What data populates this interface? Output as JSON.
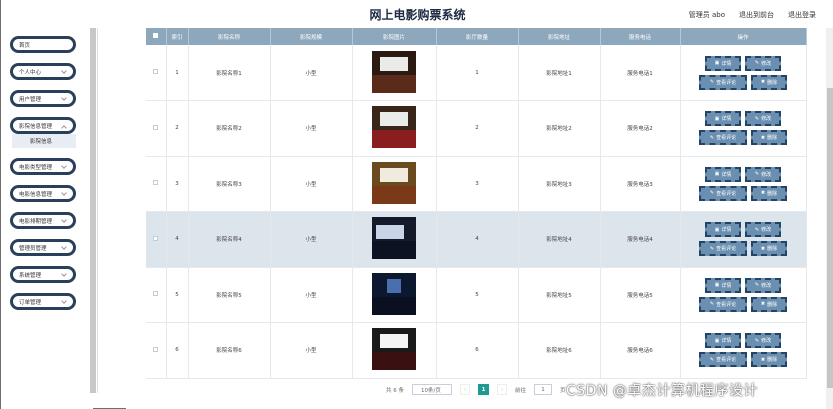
{
  "header": {
    "title": "网上电影购票系统",
    "user": "管理员 abo",
    "exit_to_frontend": "退出到前台",
    "logout": "退出登录"
  },
  "sidebar": {
    "items": [
      {
        "label": "首页"
      },
      {
        "label": "个人中心"
      },
      {
        "label": "用户管理"
      },
      {
        "label": "影院信息管理",
        "children": [
          "影院信息"
        ]
      },
      {
        "label": "电影类型管理"
      },
      {
        "label": "电影信息管理"
      },
      {
        "label": "电影排期管理"
      },
      {
        "label": "管理员管理"
      },
      {
        "label": "系统管理"
      },
      {
        "label": "订单管理"
      }
    ]
  },
  "table": {
    "columns": [
      "索引",
      "影院名称",
      "影院规模",
      "影院图片",
      "影厅数量",
      "影院地址",
      "服务电话",
      "操作"
    ],
    "rows": [
      {
        "index": "1",
        "name": "影院名称1",
        "scale": "小型",
        "halls": "1",
        "address": "影院地址1",
        "phone": "服务电话1"
      },
      {
        "index": "2",
        "name": "影院名称2",
        "scale": "小型",
        "halls": "2",
        "address": "影院地址2",
        "phone": "服务电话2"
      },
      {
        "index": "3",
        "name": "影院名称3",
        "scale": "小型",
        "halls": "3",
        "address": "影院地址3",
        "phone": "服务电话3"
      },
      {
        "index": "4",
        "name": "影院名称4",
        "scale": "小型",
        "halls": "4",
        "address": "影院地址4",
        "phone": "服务电话4"
      },
      {
        "index": "5",
        "name": "影院名称5",
        "scale": "小型",
        "halls": "5",
        "address": "影院地址5",
        "phone": "服务电话5"
      },
      {
        "index": "6",
        "name": "影院名称6",
        "scale": "小型",
        "halls": "6",
        "address": "影院地址6",
        "phone": "服务电话6"
      }
    ],
    "actions": {
      "detail": "详情",
      "edit": "修改",
      "view_reviews": "查看评论",
      "delete": "删除"
    }
  },
  "pagination": {
    "total": "共 6 条",
    "page_size": "10条/页",
    "current_page": "1",
    "goto_label": "前往",
    "goto_value": "1",
    "page_suffix": "页"
  },
  "watermark": "CSDN @卓杰计算机程序设计",
  "colors": {
    "header_row": "#8da7bd",
    "button_bg": "#6b8fb0",
    "sidebar_border": "#2a3f5c",
    "pager_active": "#1f9a92"
  }
}
